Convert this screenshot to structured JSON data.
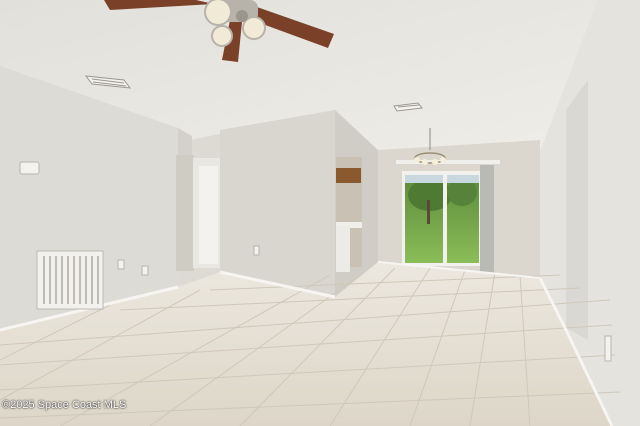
{
  "photo": {
    "subject": "empty-living-room-interior",
    "watermark_text": "©2025 Space Coast MLS"
  },
  "colors": {
    "ceiling": "#e8e6e0",
    "wall_left": "#dcdbd5",
    "wall_center": "#d6d4cd",
    "wall_back": "#dbd7cf",
    "wall_right": "#e4e3de",
    "floor": "#e4ded2",
    "grout": "#c9c2b4",
    "baseboard": "#f6f5f1",
    "fan_blade": "#7a4128",
    "fan_metal": "#b7b2aa",
    "lawn": "#7fb34d",
    "trees": "#4f7a34",
    "cabinet": "#8a5a2e"
  }
}
